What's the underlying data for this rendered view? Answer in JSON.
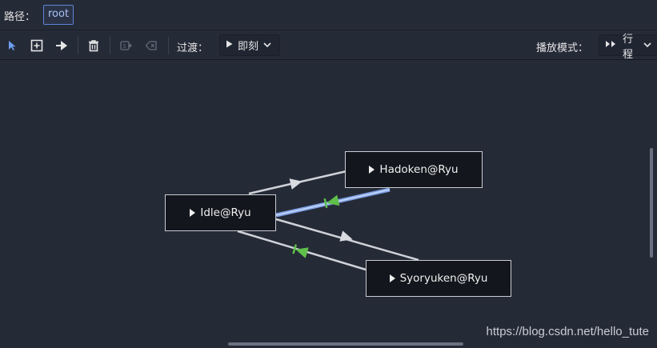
{
  "path_bar": {
    "label": "路径：",
    "current": "root"
  },
  "toolbar": {
    "transition_label": "过渡：",
    "transition_value": "即刻",
    "play_mode_label": "播放模式：",
    "play_mode_value": "行程",
    "tools": [
      "select-tool",
      "add-node-tool",
      "connect-tool",
      "delete-tool",
      "set-start-tool",
      "set-end-tool"
    ]
  },
  "graph": {
    "nodes": [
      {
        "id": "idle",
        "label": "Idle@Ryu"
      },
      {
        "id": "hadoken",
        "label": "Hadoken@Ryu"
      },
      {
        "id": "syoryuken",
        "label": "Syoryuken@Ryu"
      }
    ],
    "transitions": [
      {
        "from": "Idle@Ryu",
        "to": "Hadoken@Ryu",
        "type": "immediate"
      },
      {
        "from": "Hadoken@Ryu",
        "to": "Idle@Ryu",
        "type": "at_end",
        "playing": true
      },
      {
        "from": "Idle@Ryu",
        "to": "Syoryuken@Ryu",
        "type": "immediate"
      },
      {
        "from": "Syoryuken@Ryu",
        "to": "Idle@Ryu",
        "type": "at_end"
      }
    ]
  },
  "colors": {
    "accent": "#5d86d3",
    "active_link": "#7fa2e6",
    "auto_arrow": "#5fbf4a",
    "background": "#252a37"
  },
  "watermark": "https://blog.csdn.net/hello_tute"
}
